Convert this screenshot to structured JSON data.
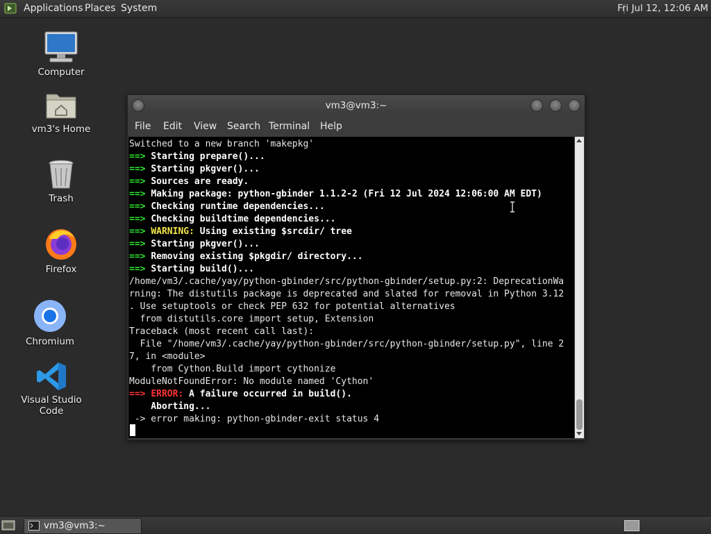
{
  "top_panel": {
    "menus": [
      "Applications",
      "Places",
      "System"
    ],
    "clock": "Fri Jul 12, 12:06 AM"
  },
  "desktop_icons": [
    {
      "label": "Computer",
      "icon": "computer-icon"
    },
    {
      "label": "vm3's Home",
      "icon": "home-folder-icon"
    },
    {
      "label": "Trash",
      "icon": "trash-icon"
    },
    {
      "label": "Firefox",
      "icon": "firefox-icon"
    },
    {
      "label": "Chromium",
      "icon": "chromium-icon"
    },
    {
      "label": "Visual Studio Code",
      "icon": "vscode-icon"
    }
  ],
  "terminal": {
    "title": "vm3@vm3:~",
    "menu": [
      "File",
      "Edit",
      "View",
      "Search",
      "Terminal",
      "Help"
    ],
    "lines": {
      "l0": "Switched to a new branch 'makepkg'",
      "arrow": "==>",
      "l1": "Starting prepare()...",
      "l2": "Starting pkgver()...",
      "l3": "Sources are ready.",
      "l4": "Making package: python-gbinder 1.1.2-2 (Fri 12 Jul 2024 12:06:00 AM EDT)",
      "l5": "Checking runtime dependencies...",
      "l6": "Checking buildtime dependencies...",
      "l7_warn": "WARNING:",
      "l7": "Using existing $srcdir/ tree",
      "l8": "Starting pkgver()...",
      "l9": "Removing existing $pkgdir/ directory...",
      "l10": "Starting build()...",
      "l11": "/home/vm3/.cache/yay/python-gbinder/src/python-gbinder/setup.py:2: DeprecationWa",
      "l12": "rning: The distutils package is deprecated and slated for removal in Python 3.12",
      "l13": ". Use setuptools or check PEP 632 for potential alternatives",
      "l14": "  from distutils.core import setup, Extension",
      "l15": "Traceback (most recent call last):",
      "l16": "  File \"/home/vm3/.cache/yay/python-gbinder/src/python-gbinder/setup.py\", line 2",
      "l17": "7, in <module>",
      "l18": "    from Cython.Build import cythonize",
      "l19": "ModuleNotFoundError: No module named 'Cython'",
      "l20_err": "ERROR:",
      "l20": "A failure occurred in build().",
      "l21": "    Aborting...",
      "l22": " -> error making: python-gbinder-exit status 4"
    }
  },
  "taskbar": {
    "task_label": "vm3@vm3:~"
  },
  "colors": {
    "prompt_arrow": "#2ee62e",
    "warning": "#f2e64a",
    "error": "#ff3333",
    "terminal_bg": "#000000"
  }
}
